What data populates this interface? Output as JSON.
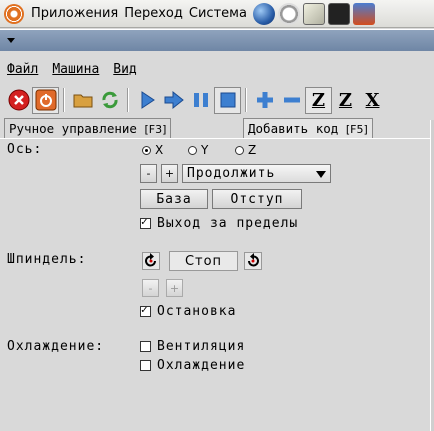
{
  "panel": {
    "menus": [
      "Приложения",
      "Переход",
      "Система"
    ],
    "applets": [
      "globe-icon",
      "clock-icon",
      "text-editor-icon",
      "terminal-icon",
      "application-icon"
    ]
  },
  "menubar": [
    "Файл",
    "Машина",
    "Вид"
  ],
  "toolbar": {
    "icons": [
      "estop-icon",
      "power-icon",
      "open-file-icon",
      "reload-icon",
      "run-icon",
      "step-icon",
      "pause-icon",
      "stop-icon",
      "zoom-in-icon",
      "zoom-out-icon",
      "view-z-icon",
      "view-z2-icon",
      "view-x-icon"
    ],
    "view_z": "Z",
    "view_z2": "Z",
    "view_x": "X"
  },
  "tabs": {
    "manual": "Ручное управление",
    "manual_key": "[F3]",
    "mdi": "Добавить код",
    "mdi_key": "[F5]"
  },
  "axis": {
    "label": "Ось:",
    "options": [
      "X",
      "Y",
      "Z"
    ],
    "selected": "X",
    "minus": "-",
    "plus": "+",
    "jog_mode": "Продолжить",
    "home": "База",
    "touch_off": "Отступ",
    "override_limits": "Выход за пределы",
    "override_limits_checked": true
  },
  "spindle": {
    "label": "Шпиндель:",
    "stop": "Стоп",
    "minus": "-",
    "plus": "+",
    "brake": "Остановка",
    "brake_checked": true
  },
  "coolant": {
    "label": "Охлаждение:",
    "mist": "Вентиляция",
    "flood": "Охлаждение",
    "mist_checked": false,
    "flood_checked": false
  },
  "colors": {
    "estop": "#d42020",
    "run": "#3d7fd0",
    "power": "#e06a2a",
    "accent": "#2a5ea8"
  }
}
